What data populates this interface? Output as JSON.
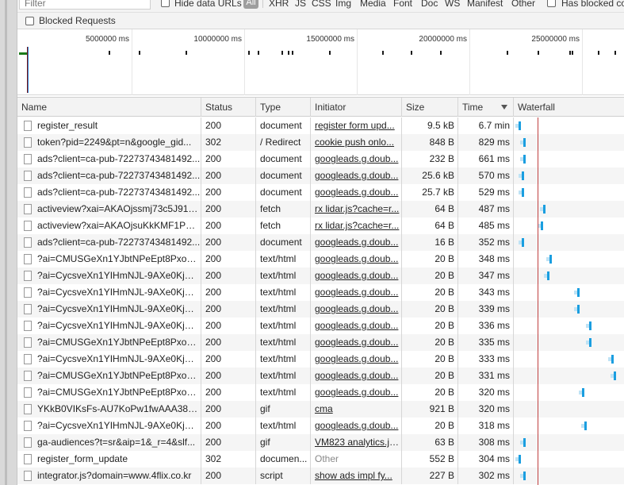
{
  "filter": {
    "placeholder": "Filter",
    "hide_data_urls": "Hide data URLs",
    "types": [
      "All",
      "XHR",
      "JS",
      "CSS",
      "Img",
      "Media",
      "Font",
      "Doc",
      "WS",
      "Manifest",
      "Other"
    ],
    "has_blocked": "Has blocked co"
  },
  "blocked_requests": "Blocked Requests",
  "overview": {
    "ticks": [
      "5000000 ms",
      "10000000 ms",
      "15000000 ms",
      "20000000 ms",
      "25000000 ms"
    ]
  },
  "columns": [
    "Name",
    "Status",
    "Type",
    "Initiator",
    "Size",
    "Time",
    "Waterfall"
  ],
  "rows": [
    {
      "name": "register_result",
      "status": "200",
      "type": "document",
      "initiator": "register form upd...",
      "init_style": "link",
      "size": "9.5 kB",
      "time": "6.7 min",
      "wf": 654
    },
    {
      "name": "token?pid=2249&pt=n&google_gid...",
      "status": "302",
      "type": "/ Redirect",
      "initiator": "cookie push onlo...",
      "init_style": "link",
      "size": "848 B",
      "time": "829 ms",
      "wf": 660
    },
    {
      "name": "ads?client=ca-pub-72273743481492...",
      "status": "200",
      "type": "document",
      "initiator": "googleads.g.doub...",
      "init_style": "link",
      "size": "232 B",
      "time": "661 ms",
      "wf": 660
    },
    {
      "name": "ads?client=ca-pub-72273743481492...",
      "status": "200",
      "type": "document",
      "initiator": "googleads.g.doub...",
      "init_style": "link",
      "size": "25.6 kB",
      "time": "570 ms",
      "wf": 658
    },
    {
      "name": "ads?client=ca-pub-72273743481492...",
      "status": "200",
      "type": "document",
      "initiator": "googleads.g.doub...",
      "init_style": "link",
      "size": "25.7 kB",
      "time": "529 ms",
      "wf": 658
    },
    {
      "name": "activeview?xai=AKAOjssmj73c5J91d...",
      "status": "200",
      "type": "fetch",
      "initiator": "rx lidar.js?cache=r...",
      "init_style": "link",
      "size": "64 B",
      "time": "487 ms",
      "wf": 685
    },
    {
      "name": "activeview?xai=AKAOjsuKkKMF1PBv...",
      "status": "200",
      "type": "fetch",
      "initiator": "rx lidar.js?cache=r...",
      "init_style": "link",
      "size": "64 B",
      "time": "485 ms",
      "wf": 682
    },
    {
      "name": "ads?client=ca-pub-72273743481492...",
      "status": "200",
      "type": "document",
      "initiator": "googleads.g.doub...",
      "init_style": "link",
      "size": "16 B",
      "time": "352 ms",
      "wf": 658
    },
    {
      "name": "?ai=CMUSGeXn1YJbtNPeEpt8PxoGz...",
      "status": "200",
      "type": "text/html",
      "initiator": "googleads.g.doub...",
      "init_style": "link",
      "size": "20 B",
      "time": "348 ms",
      "wf": 693
    },
    {
      "name": "?ai=CycsveXn1YIHmNJL-9AXe0KjwA...",
      "status": "200",
      "type": "text/html",
      "initiator": "googleads.g.doub...",
      "init_style": "link",
      "size": "20 B",
      "time": "347 ms",
      "wf": 690
    },
    {
      "name": "?ai=CycsveXn1YIHmNJL-9AXe0KjwA...",
      "status": "200",
      "type": "text/html",
      "initiator": "googleads.g.doub...",
      "init_style": "link",
      "size": "20 B",
      "time": "343 ms",
      "wf": 728
    },
    {
      "name": "?ai=CycsveXn1YIHmNJL-9AXe0KjwA...",
      "status": "200",
      "type": "text/html",
      "initiator": "googleads.g.doub...",
      "init_style": "link",
      "size": "20 B",
      "time": "339 ms",
      "wf": 728
    },
    {
      "name": "?ai=CycsveXn1YIHmNJL-9AXe0KjwA...",
      "status": "200",
      "type": "text/html",
      "initiator": "googleads.g.doub...",
      "init_style": "link",
      "size": "20 B",
      "time": "336 ms",
      "wf": 743
    },
    {
      "name": "?ai=CMUSGeXn1YJbtNPeEpt8PxoGz...",
      "status": "200",
      "type": "text/html",
      "initiator": "googleads.g.doub...",
      "init_style": "link",
      "size": "20 B",
      "time": "335 ms",
      "wf": 743
    },
    {
      "name": "?ai=CycsveXn1YIHmNJL-9AXe0KjwA...",
      "status": "200",
      "type": "text/html",
      "initiator": "googleads.g.doub...",
      "init_style": "link",
      "size": "20 B",
      "time": "333 ms",
      "wf": 771
    },
    {
      "name": "?ai=CMUSGeXn1YJbtNPeEpt8PxoGz...",
      "status": "200",
      "type": "text/html",
      "initiator": "googleads.g.doub...",
      "init_style": "link",
      "size": "20 B",
      "time": "331 ms",
      "wf": 774
    },
    {
      "name": "?ai=CMUSGeXn1YJbtNPeEpt8PxoGz...",
      "status": "200",
      "type": "text/html",
      "initiator": "googleads.g.doub...",
      "init_style": "link",
      "size": "20 B",
      "time": "320 ms",
      "wf": 734
    },
    {
      "name": "YKkB0VIKsFs-AU7KoPw1fwAAA38AA...",
      "status": "200",
      "type": "gif",
      "initiator": "cma",
      "init_style": "link",
      "size": "921 B",
      "time": "320 ms",
      "wf": 0
    },
    {
      "name": "?ai=CycsveXn1YIHmNJL-9AXe0KjwA...",
      "status": "200",
      "type": "text/html",
      "initiator": "googleads.g.doub...",
      "init_style": "link",
      "size": "20 B",
      "time": "318 ms",
      "wf": 737
    },
    {
      "name": "ga-audiences?t=sr&aip=1&_r=4&slf...",
      "status": "200",
      "type": "gif",
      "initiator": "VM823 analytics.js...",
      "init_style": "link",
      "size": "63 B",
      "time": "308 ms",
      "wf": 660
    },
    {
      "name": "register_form_update",
      "status": "302",
      "type": "documen...",
      "initiator": "Other",
      "init_style": "other",
      "size": "552 B",
      "time": "304 ms",
      "wf": 654
    },
    {
      "name": "integrator.js?domain=www.4flix.co.kr",
      "status": "200",
      "type": "script",
      "initiator": "show ads impl fy...",
      "init_style": "link",
      "size": "227 B",
      "time": "302 ms",
      "wf": 660
    }
  ]
}
